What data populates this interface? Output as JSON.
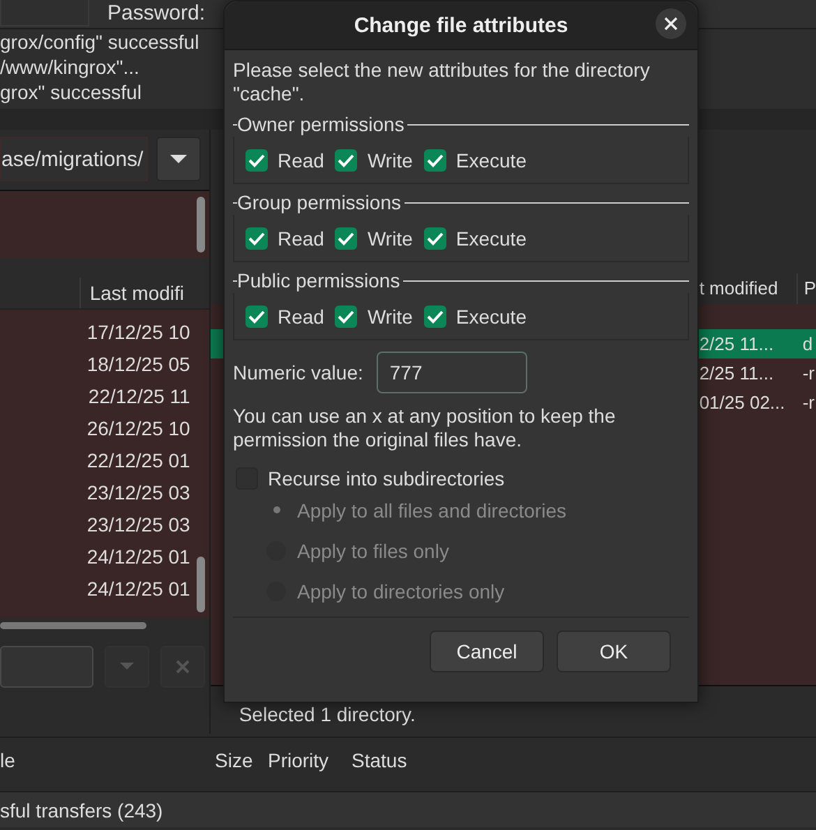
{
  "quickconnect": {
    "password_label": "Password:"
  },
  "log": [
    "grox/config\" successful",
    "/www/kingrox\"...",
    "grox\" successful"
  ],
  "left_pane": {
    "path": "ase/migrations/",
    "columns": [
      "Last modifi"
    ],
    "rows": [
      "17/12/25 10",
      "18/12/25 05",
      "22/12/25 11",
      "26/12/25 10",
      "22/12/25 01",
      "23/12/25 03",
      "23/12/25 03",
      "24/12/25 01",
      "24/12/25 01"
    ]
  },
  "right_pane": {
    "columns": [
      "t modified",
      "P"
    ],
    "rows": [
      {
        "cells": [
          "2/25 11...",
          "d"
        ],
        "selected": true
      },
      {
        "cells": [
          "2/25 11...",
          "-r"
        ],
        "selected": false
      },
      {
        "cells": [
          "01/25 02...",
          "-r"
        ],
        "selected": false
      }
    ],
    "status": "Selected 1 directory."
  },
  "dialog": {
    "title": "Change file attributes",
    "intro": "Please select the new attributes for the directory \"cache\".",
    "groups": [
      {
        "label": "Owner permissions",
        "options": [
          {
            "label": "Read",
            "checked": true
          },
          {
            "label": "Write",
            "checked": true
          },
          {
            "label": "Execute",
            "checked": true
          }
        ]
      },
      {
        "label": "Group permissions",
        "options": [
          {
            "label": "Read",
            "checked": true
          },
          {
            "label": "Write",
            "checked": true
          },
          {
            "label": "Execute",
            "checked": true
          }
        ]
      },
      {
        "label": "Public permissions",
        "options": [
          {
            "label": "Read",
            "checked": true
          },
          {
            "label": "Write",
            "checked": true
          },
          {
            "label": "Execute",
            "checked": true
          }
        ]
      }
    ],
    "numeric": {
      "label": "Numeric value:",
      "value": "777"
    },
    "hint": "You can use an x at any position to keep the permission the original files have.",
    "recurse": {
      "label": "Recurse into subdirectories",
      "checked": false
    },
    "apply_options": [
      {
        "label": "Apply to all files and directories",
        "selected": true,
        "disabled": true
      },
      {
        "label": "Apply to files only",
        "selected": false,
        "disabled": true
      },
      {
        "label": "Apply to directories only",
        "selected": false,
        "disabled": true
      }
    ],
    "buttons": [
      "Cancel",
      "OK"
    ]
  },
  "queue": {
    "columns": [
      "le",
      "Size",
      "Priority",
      "Status"
    ]
  },
  "status_bar": {
    "text": "sful transfers (243)"
  }
}
